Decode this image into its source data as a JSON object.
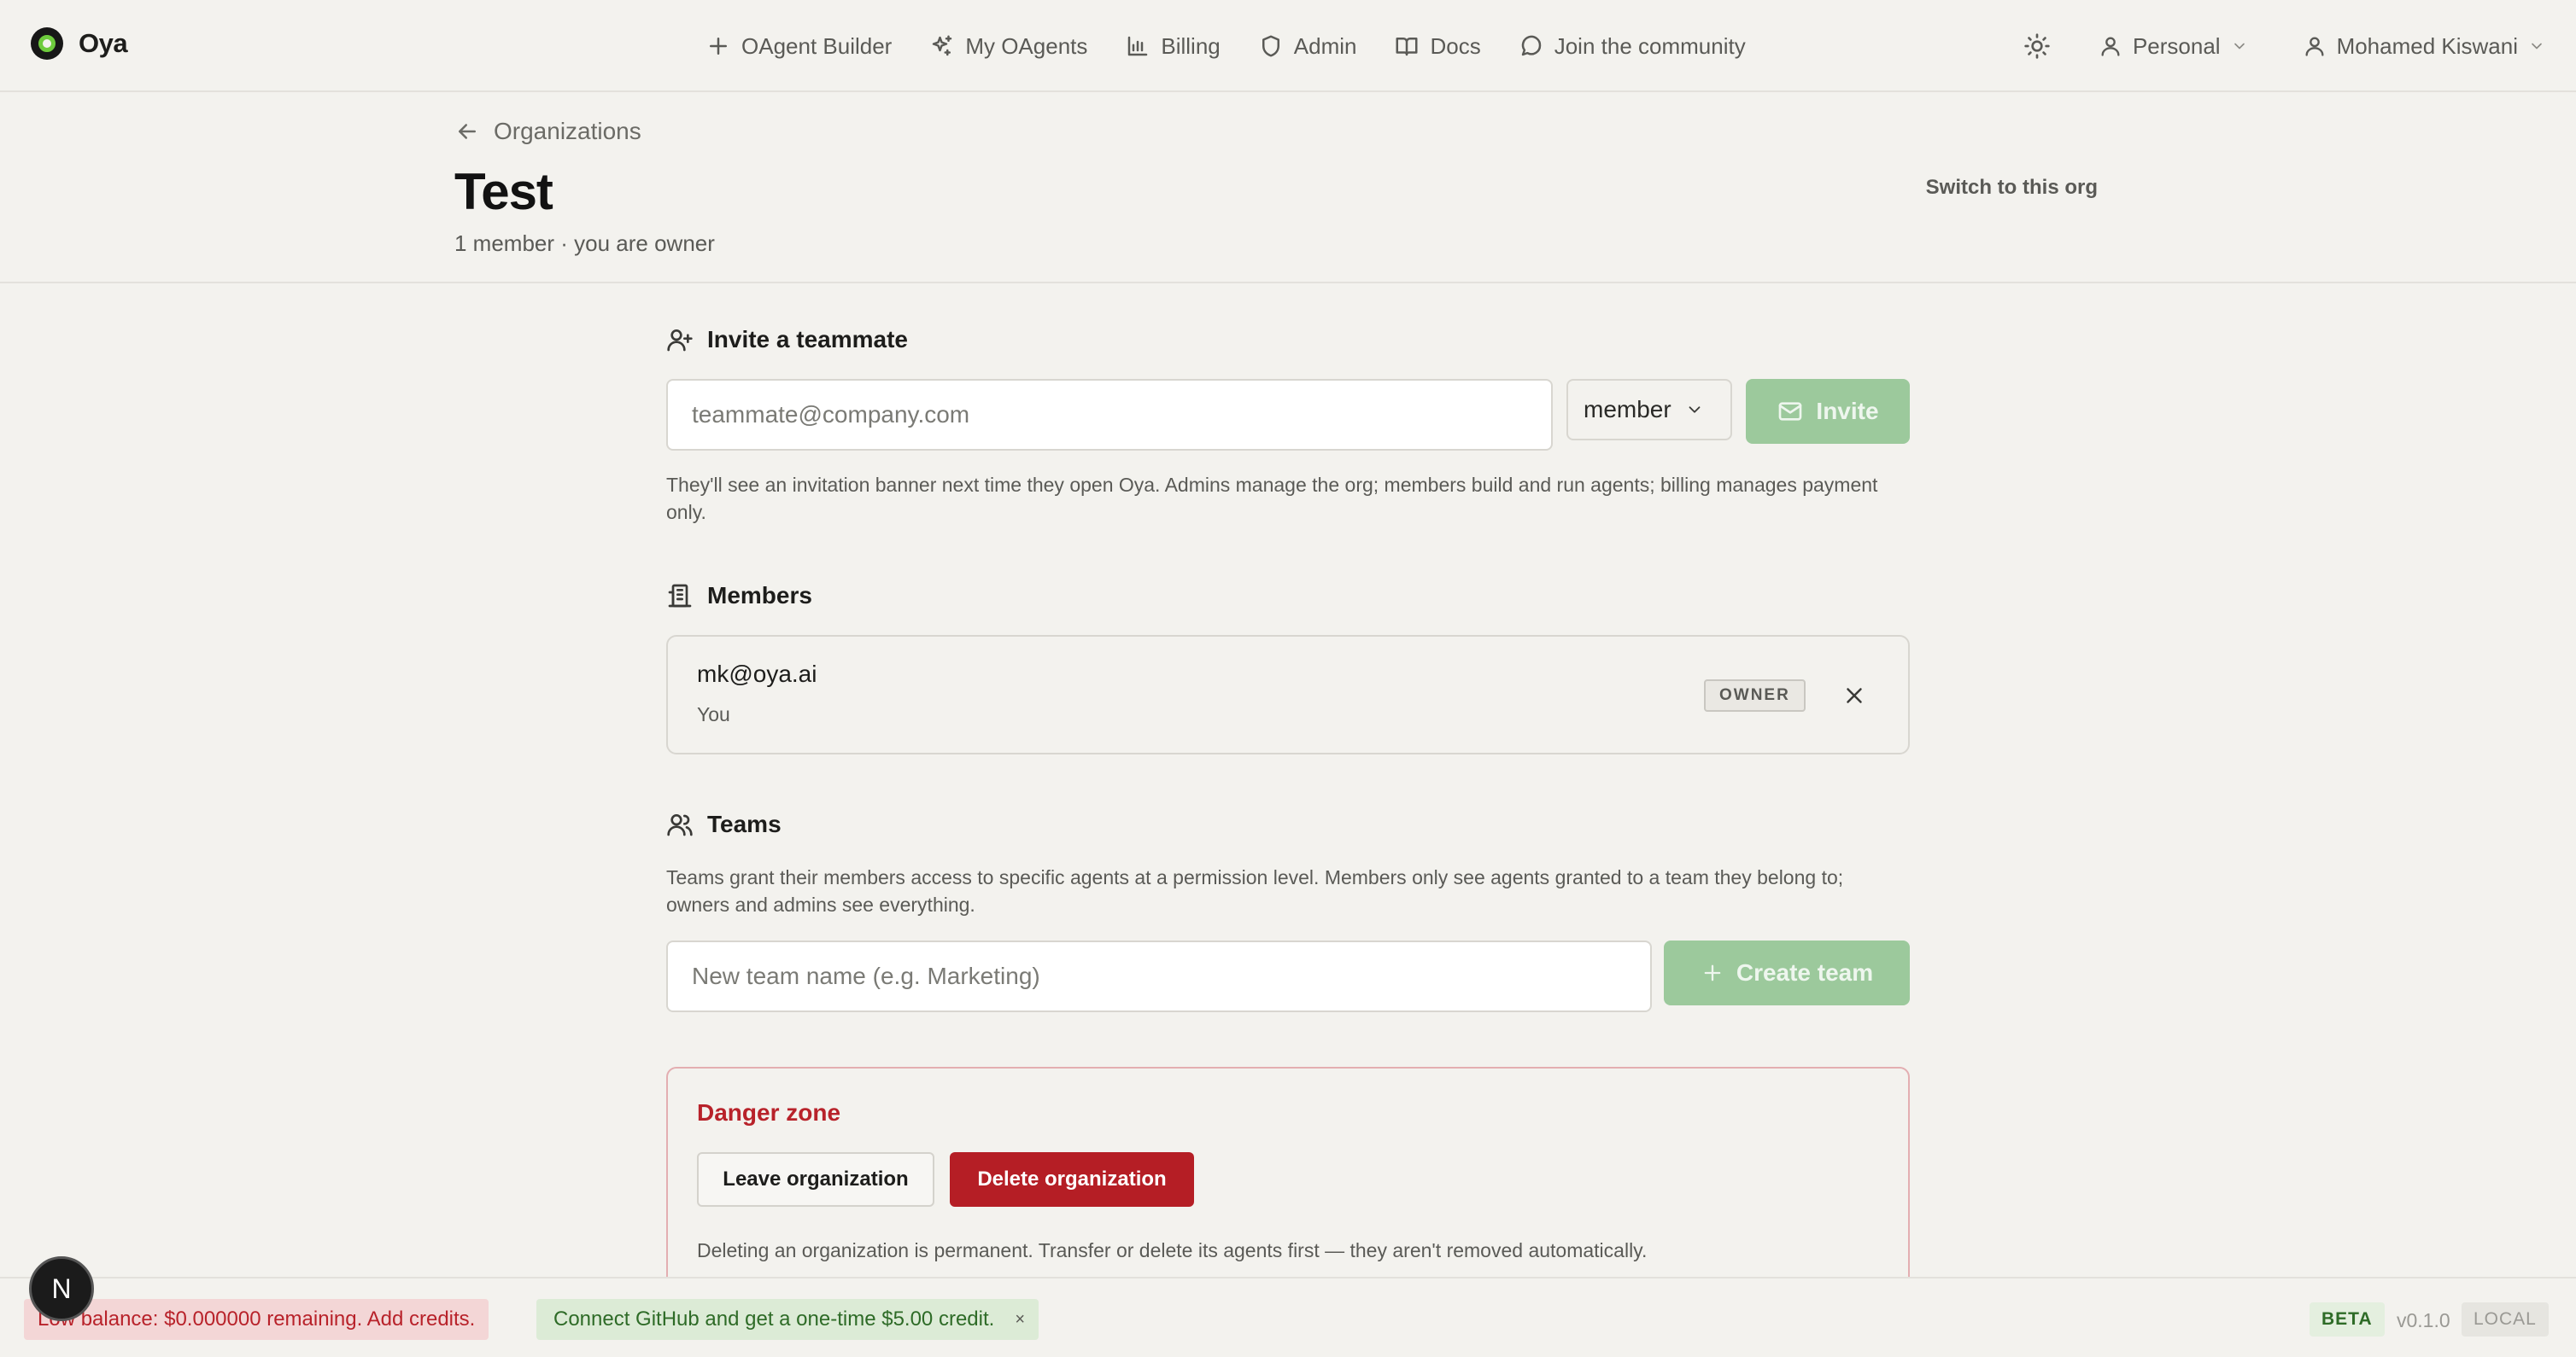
{
  "brand": {
    "name": "Oya"
  },
  "nav": {
    "links": [
      {
        "label": "OAgent Builder",
        "icon": "plus-icon"
      },
      {
        "label": "My OAgents",
        "icon": "sparkles-icon"
      },
      {
        "label": "Billing",
        "icon": "bar-chart-icon"
      },
      {
        "label": "Admin",
        "icon": "shield-icon"
      },
      {
        "label": "Docs",
        "icon": "book-open-icon"
      },
      {
        "label": "Join the community",
        "icon": "message-circle-icon"
      }
    ],
    "workspace": "Personal",
    "user": "Mohamed Kiswani"
  },
  "header": {
    "back_label": "Organizations",
    "org_name": "Test",
    "meta": "1 member · you are owner",
    "switch_label": "Switch to this org"
  },
  "invite": {
    "title": "Invite a teammate",
    "email_placeholder": "teammate@company.com",
    "role_value": "member",
    "button_label": "Invite",
    "help": "They'll see an invitation banner next time they open Oya. Admins manage the org; members build and run agents; billing manages payment only."
  },
  "members": {
    "title": "Members",
    "items": [
      {
        "email": "mk@oya.ai",
        "note": "You",
        "role": "OWNER"
      }
    ]
  },
  "teams": {
    "title": "Teams",
    "help": "Teams grant their members access to specific agents at a permission level. Members only see agents granted to a team they belong to; owners and admins see everything.",
    "name_placeholder": "New team name (e.g. Marketing)",
    "create_label": "Create team"
  },
  "danger": {
    "title": "Danger zone",
    "leave_label": "Leave organization",
    "delete_label": "Delete organization",
    "help": "Deleting an organization is permanent. Transfer or delete its agents first — they aren't removed automatically."
  },
  "statusbar": {
    "balance_text": "Low balance: $0.000000 remaining. Add credits.",
    "github_text": "Connect GitHub and get a one-time $5.00 credit.",
    "github_close": "×",
    "beta": "BETA",
    "version": "v0.1.0",
    "env": "LOCAL"
  },
  "fab": {
    "label": "N"
  },
  "colors": {
    "background": "#f3f2ee",
    "accent_green": "#9cc99c",
    "danger_red": "#b51e25",
    "brand_green": "#6ecb3d"
  }
}
